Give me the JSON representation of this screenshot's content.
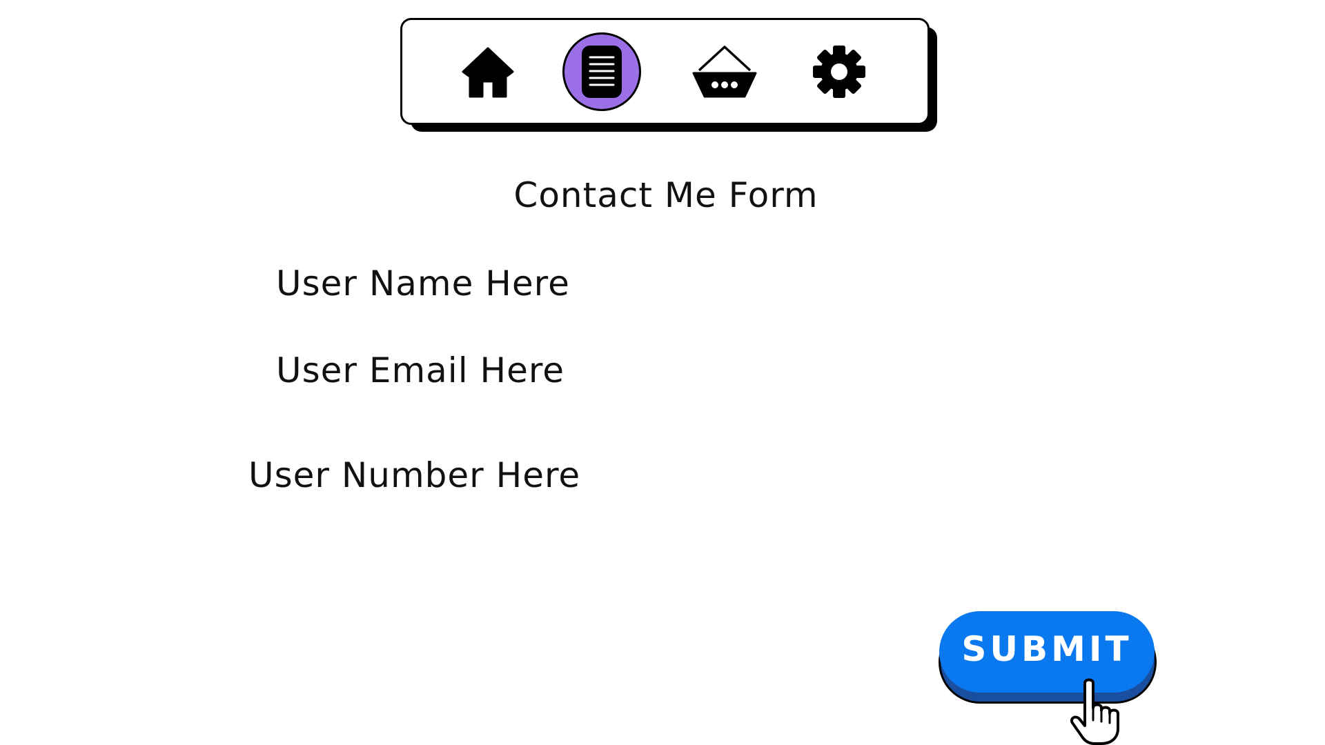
{
  "nav": {
    "items": [
      {
        "icon": "home-icon",
        "active": false
      },
      {
        "icon": "form-list-icon",
        "active": true
      },
      {
        "icon": "basket-icon",
        "active": false
      },
      {
        "icon": "gear-icon",
        "active": false
      }
    ],
    "active_color": "#9b6fe6"
  },
  "form": {
    "title": "Contact Me Form",
    "name_label": "User Name Here",
    "email_label": "User Email Here",
    "number_label": "User Number Here",
    "submit_label": "SUBMIT"
  },
  "colors": {
    "submit": "#0a79f0",
    "submit_shadow": "#1a4fa0"
  }
}
